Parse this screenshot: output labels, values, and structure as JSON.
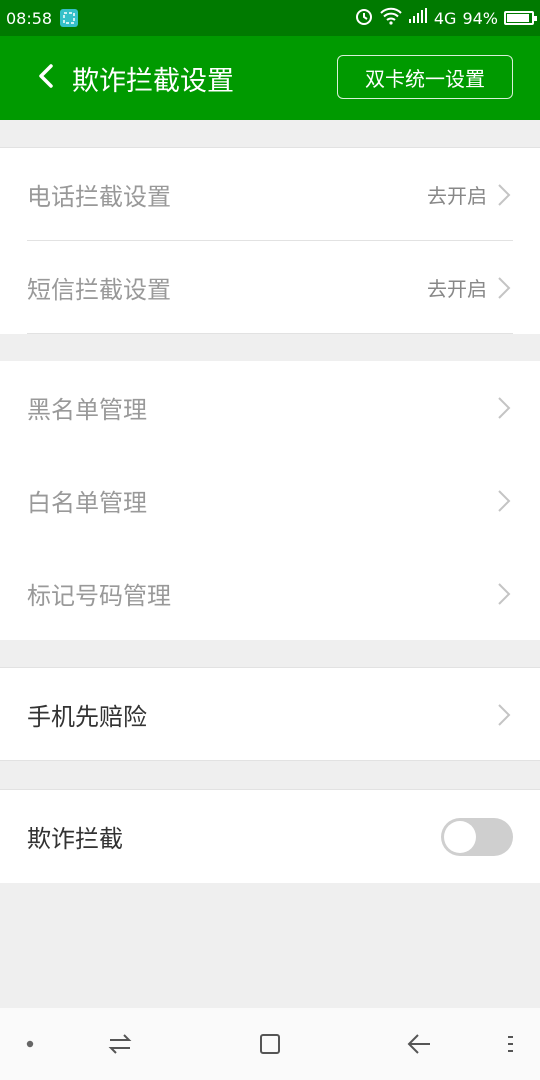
{
  "status_bar": {
    "time": "08:58",
    "network": "4G",
    "battery": "94%",
    "battery_level": 0.94,
    "icons": [
      "screenshot-app-icon",
      "alarm-icon",
      "wifi-icon",
      "signal-icon",
      "battery-icon"
    ]
  },
  "header": {
    "title": "欺诈拦截设置",
    "dual_sim_button": "双卡统一设置",
    "background": "#009a00"
  },
  "sections": {
    "call_block": {
      "label": "电话拦截设置",
      "status": "去开启"
    },
    "sms_block": {
      "label": "短信拦截设置",
      "status": "去开启"
    },
    "blacklist": {
      "label": "黑名单管理"
    },
    "whitelist": {
      "label": "白名单管理"
    },
    "marked_numbers": {
      "label": "标记号码管理"
    },
    "phone_insurance": {
      "label": "手机先赔险"
    },
    "fraud_block": {
      "label": "欺诈拦截",
      "enabled": false
    }
  },
  "nav_bar": {
    "icons": [
      "menu-dot-icon",
      "switch-icon",
      "home-square-icon",
      "back-arrow-icon",
      "more-icon"
    ]
  }
}
